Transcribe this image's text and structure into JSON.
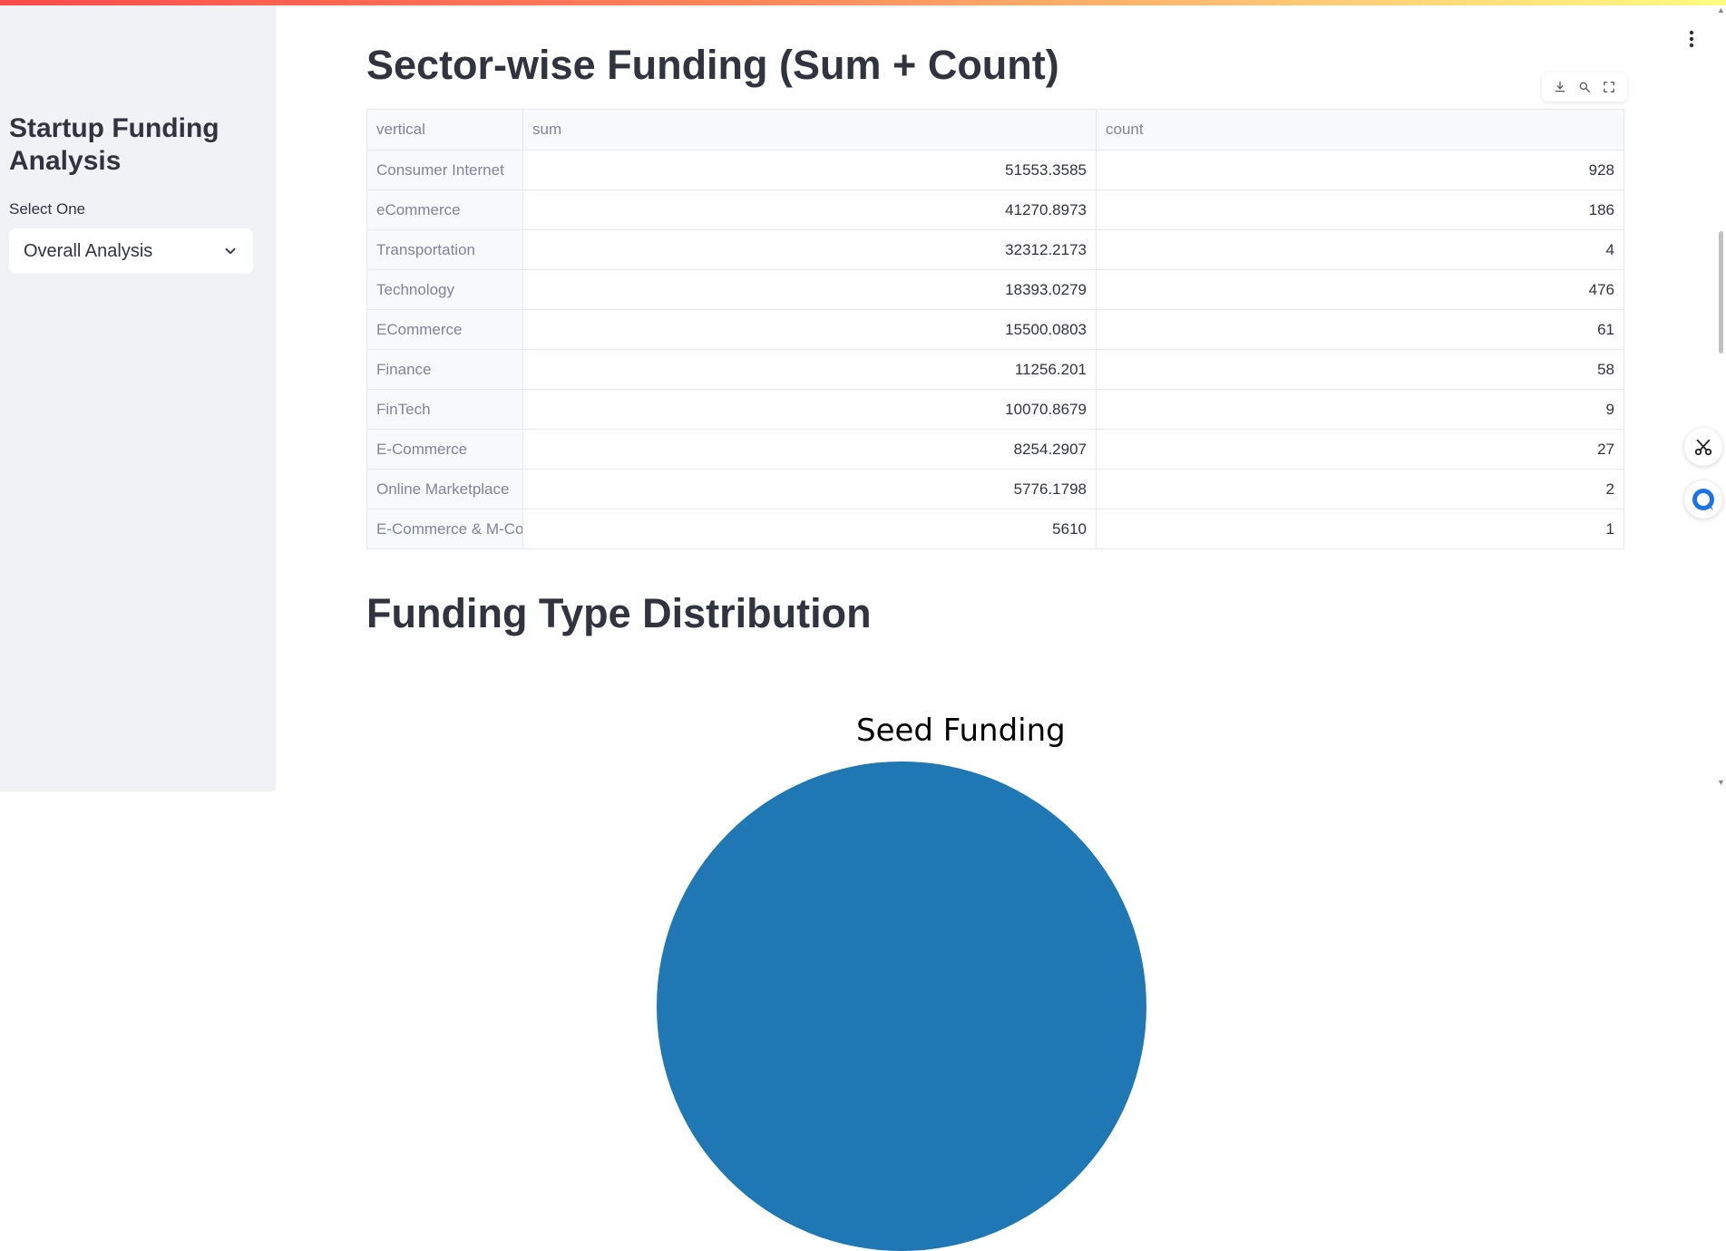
{
  "sidebar": {
    "title": "Startup Funding Analysis",
    "select_label": "Select One",
    "select_value": "Overall Analysis"
  },
  "main": {
    "page_title": "Sector-wise Funding (Sum + Count)",
    "section_title": "Funding Type Distribution",
    "chart_title": "Seed Funding"
  },
  "table": {
    "columns": [
      "vertical",
      "sum",
      "count"
    ],
    "rows": [
      [
        "Consumer Internet",
        "51553.3585",
        "928"
      ],
      [
        "eCommerce",
        "41270.8973",
        "186"
      ],
      [
        "Transportation",
        "32312.2173",
        "4"
      ],
      [
        "Technology",
        "18393.0279",
        "476"
      ],
      [
        "ECommerce",
        "15500.0803",
        "61"
      ],
      [
        "Finance",
        "11256.201",
        "58"
      ],
      [
        "FinTech",
        "10070.8679",
        "9"
      ],
      [
        "E-Commerce",
        "8254.2907",
        "27"
      ],
      [
        "Online Marketplace",
        "5776.1798",
        "2"
      ],
      [
        "E-Commerce & M-Commerce",
        "5610",
        "1"
      ]
    ]
  },
  "toolbar": {
    "icons": [
      "download-icon",
      "search-icon",
      "fullscreen-icon"
    ]
  },
  "colors": {
    "accent": "#ff4b4b",
    "pie": "#1f77b4",
    "sidebar_bg": "#f0f2f6"
  }
}
